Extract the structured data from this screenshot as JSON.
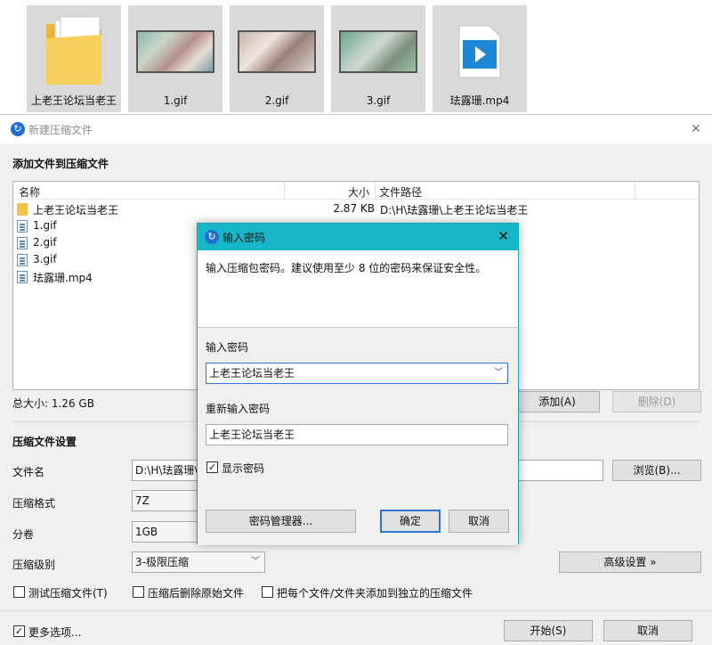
{
  "desktop": {
    "files": [
      {
        "name": "上老王论坛当老王",
        "type": "folder"
      },
      {
        "name": "1.gif",
        "type": "image"
      },
      {
        "name": "2.gif",
        "type": "image"
      },
      {
        "name": "3.gif",
        "type": "image"
      },
      {
        "name": "珐露珊.mp4",
        "type": "video"
      }
    ]
  },
  "main_dialog": {
    "title": "新建压缩文件",
    "add_files_heading": "添加文件到压缩文件",
    "columns": {
      "name": "名称",
      "size": "大小",
      "path": "文件路径"
    },
    "rows": [
      {
        "name": "上老王论坛当老王",
        "size": "2.87 KB",
        "path": "D:\\H\\珐露珊\\上老王论坛当老王",
        "icon": "folder-icon"
      },
      {
        "name": "1.gif",
        "size": "",
        "path": "",
        "icon": "file-icon"
      },
      {
        "name": "2.gif",
        "size": "",
        "path": "",
        "icon": "file-icon"
      },
      {
        "name": "3.gif",
        "size": "",
        "path": "",
        "icon": "file-icon"
      },
      {
        "name": "珐露珊.mp4",
        "size": "",
        "path": "",
        "icon": "file-icon"
      }
    ],
    "total_size": "总大小: 1.26 GB",
    "add_button": "添加(A)",
    "delete_button": "删除(D)",
    "settings_heading": "压缩文件设置",
    "filename_label": "文件名",
    "filename_value": "D:\\H\\珐露珊\\",
    "browse_button": "浏览(B)...",
    "format_label": "压缩格式",
    "format_value": "7Z",
    "split_label": "分卷",
    "split_value": "1GB",
    "level_label": "压缩级别",
    "level_value": "3-极限压缩",
    "advanced_button": "高级设置 »",
    "test_checkbox": "测试压缩文件(T)",
    "delete_after_checkbox": "压缩后删除原始文件",
    "separate_checkbox": "把每个文件/文件夹添加到独立的压缩文件",
    "more_options": "更多选项...",
    "start_button": "开始(S)",
    "cancel_button": "取消"
  },
  "password_dialog": {
    "title": "输入密码",
    "description": "输入压缩包密码。建议使用至少 8 位的密码来保证安全性。",
    "password_label": "输入密码",
    "password_value": "上老王论坛当老王",
    "confirm_label": "重新输入密码",
    "confirm_value": "上老王论坛当老王",
    "show_password": "显示密码",
    "show_password_checked": true,
    "manager_button": "密码管理器...",
    "ok_button": "确定",
    "cancel_button": "取消"
  },
  "colors": {
    "accent": "#18b7c7",
    "primary_border": "#2a75d5",
    "folder": "#f3c247"
  }
}
